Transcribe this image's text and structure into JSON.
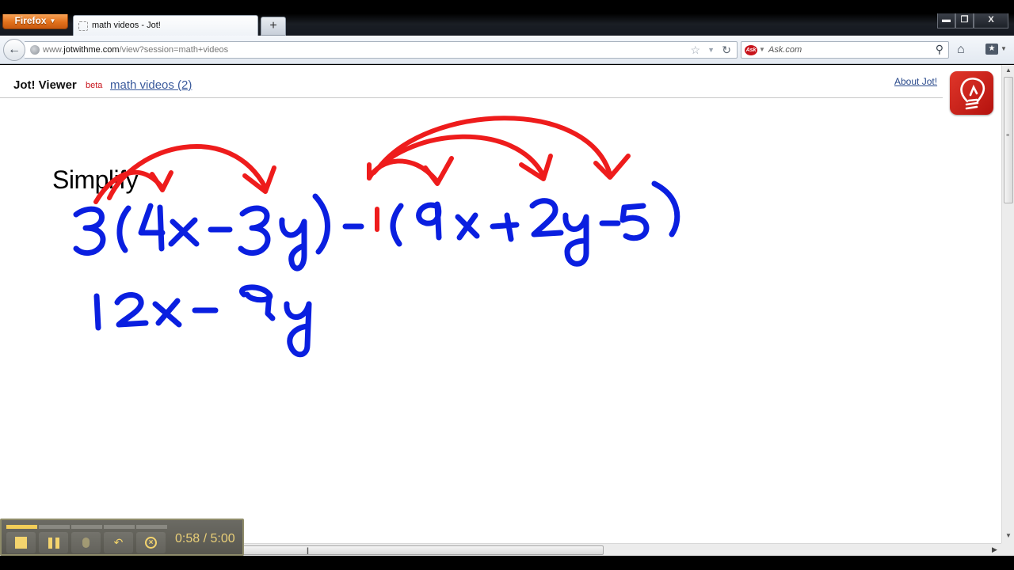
{
  "browser": {
    "app_button_label": "Firefox",
    "tab_title": "math videos - Jot!",
    "new_tab_label": "+",
    "window_controls": [
      "minimize",
      "restore",
      "close"
    ],
    "url_domain_prefix": "www.",
    "url_domain": "jotwithme.com",
    "url_path": "/view?session=math+videos",
    "search_engine": "Ask.com",
    "search_placeholder": "Ask.com",
    "icons": {
      "back": "back-arrow-icon",
      "globe": "globe-icon",
      "star": "bookmark-star-icon",
      "dropdown": "history-dropdown-icon",
      "reload": "reload-icon",
      "search": "magnifier-icon",
      "home": "home-icon",
      "bookmarks": "bookmarks-menu-icon"
    }
  },
  "jot": {
    "title": "Jot! Viewer",
    "beta_label": "beta",
    "session_link": "math videos (2)",
    "about_link": "About Jot!",
    "logo": "lightbulb-logo-icon",
    "colors": {
      "ink_blue": "#0a1fe0",
      "ink_red": "#ee1c1c",
      "beta_red": "#c8141c",
      "link_blue": "#3a5a9c"
    }
  },
  "whiteboard": {
    "heading": "Simplify",
    "expression": "3(4x-3y)-1(9x+2y-5)",
    "distribution_arrows": [
      {
        "from": "3",
        "to": "4x"
      },
      {
        "from": "3",
        "to": "-3y"
      },
      {
        "from": "-1",
        "to": "9x"
      },
      {
        "from": "-1",
        "to": "+2y"
      },
      {
        "from": "-1",
        "to": "-5"
      }
    ],
    "work_lines": [
      "12x - 9y"
    ]
  },
  "recorder": {
    "elapsed": "0:58",
    "total": "5:00",
    "time_display": "0:58 / 5:00",
    "progress_fraction": 0.193,
    "progress_segments_total": 5,
    "buttons": [
      "stop",
      "pause",
      "microphone",
      "undo",
      "close"
    ]
  },
  "scrollbars": {
    "vertical_position_fraction": 0.0,
    "horizontal_position_fraction": 0.3
  }
}
